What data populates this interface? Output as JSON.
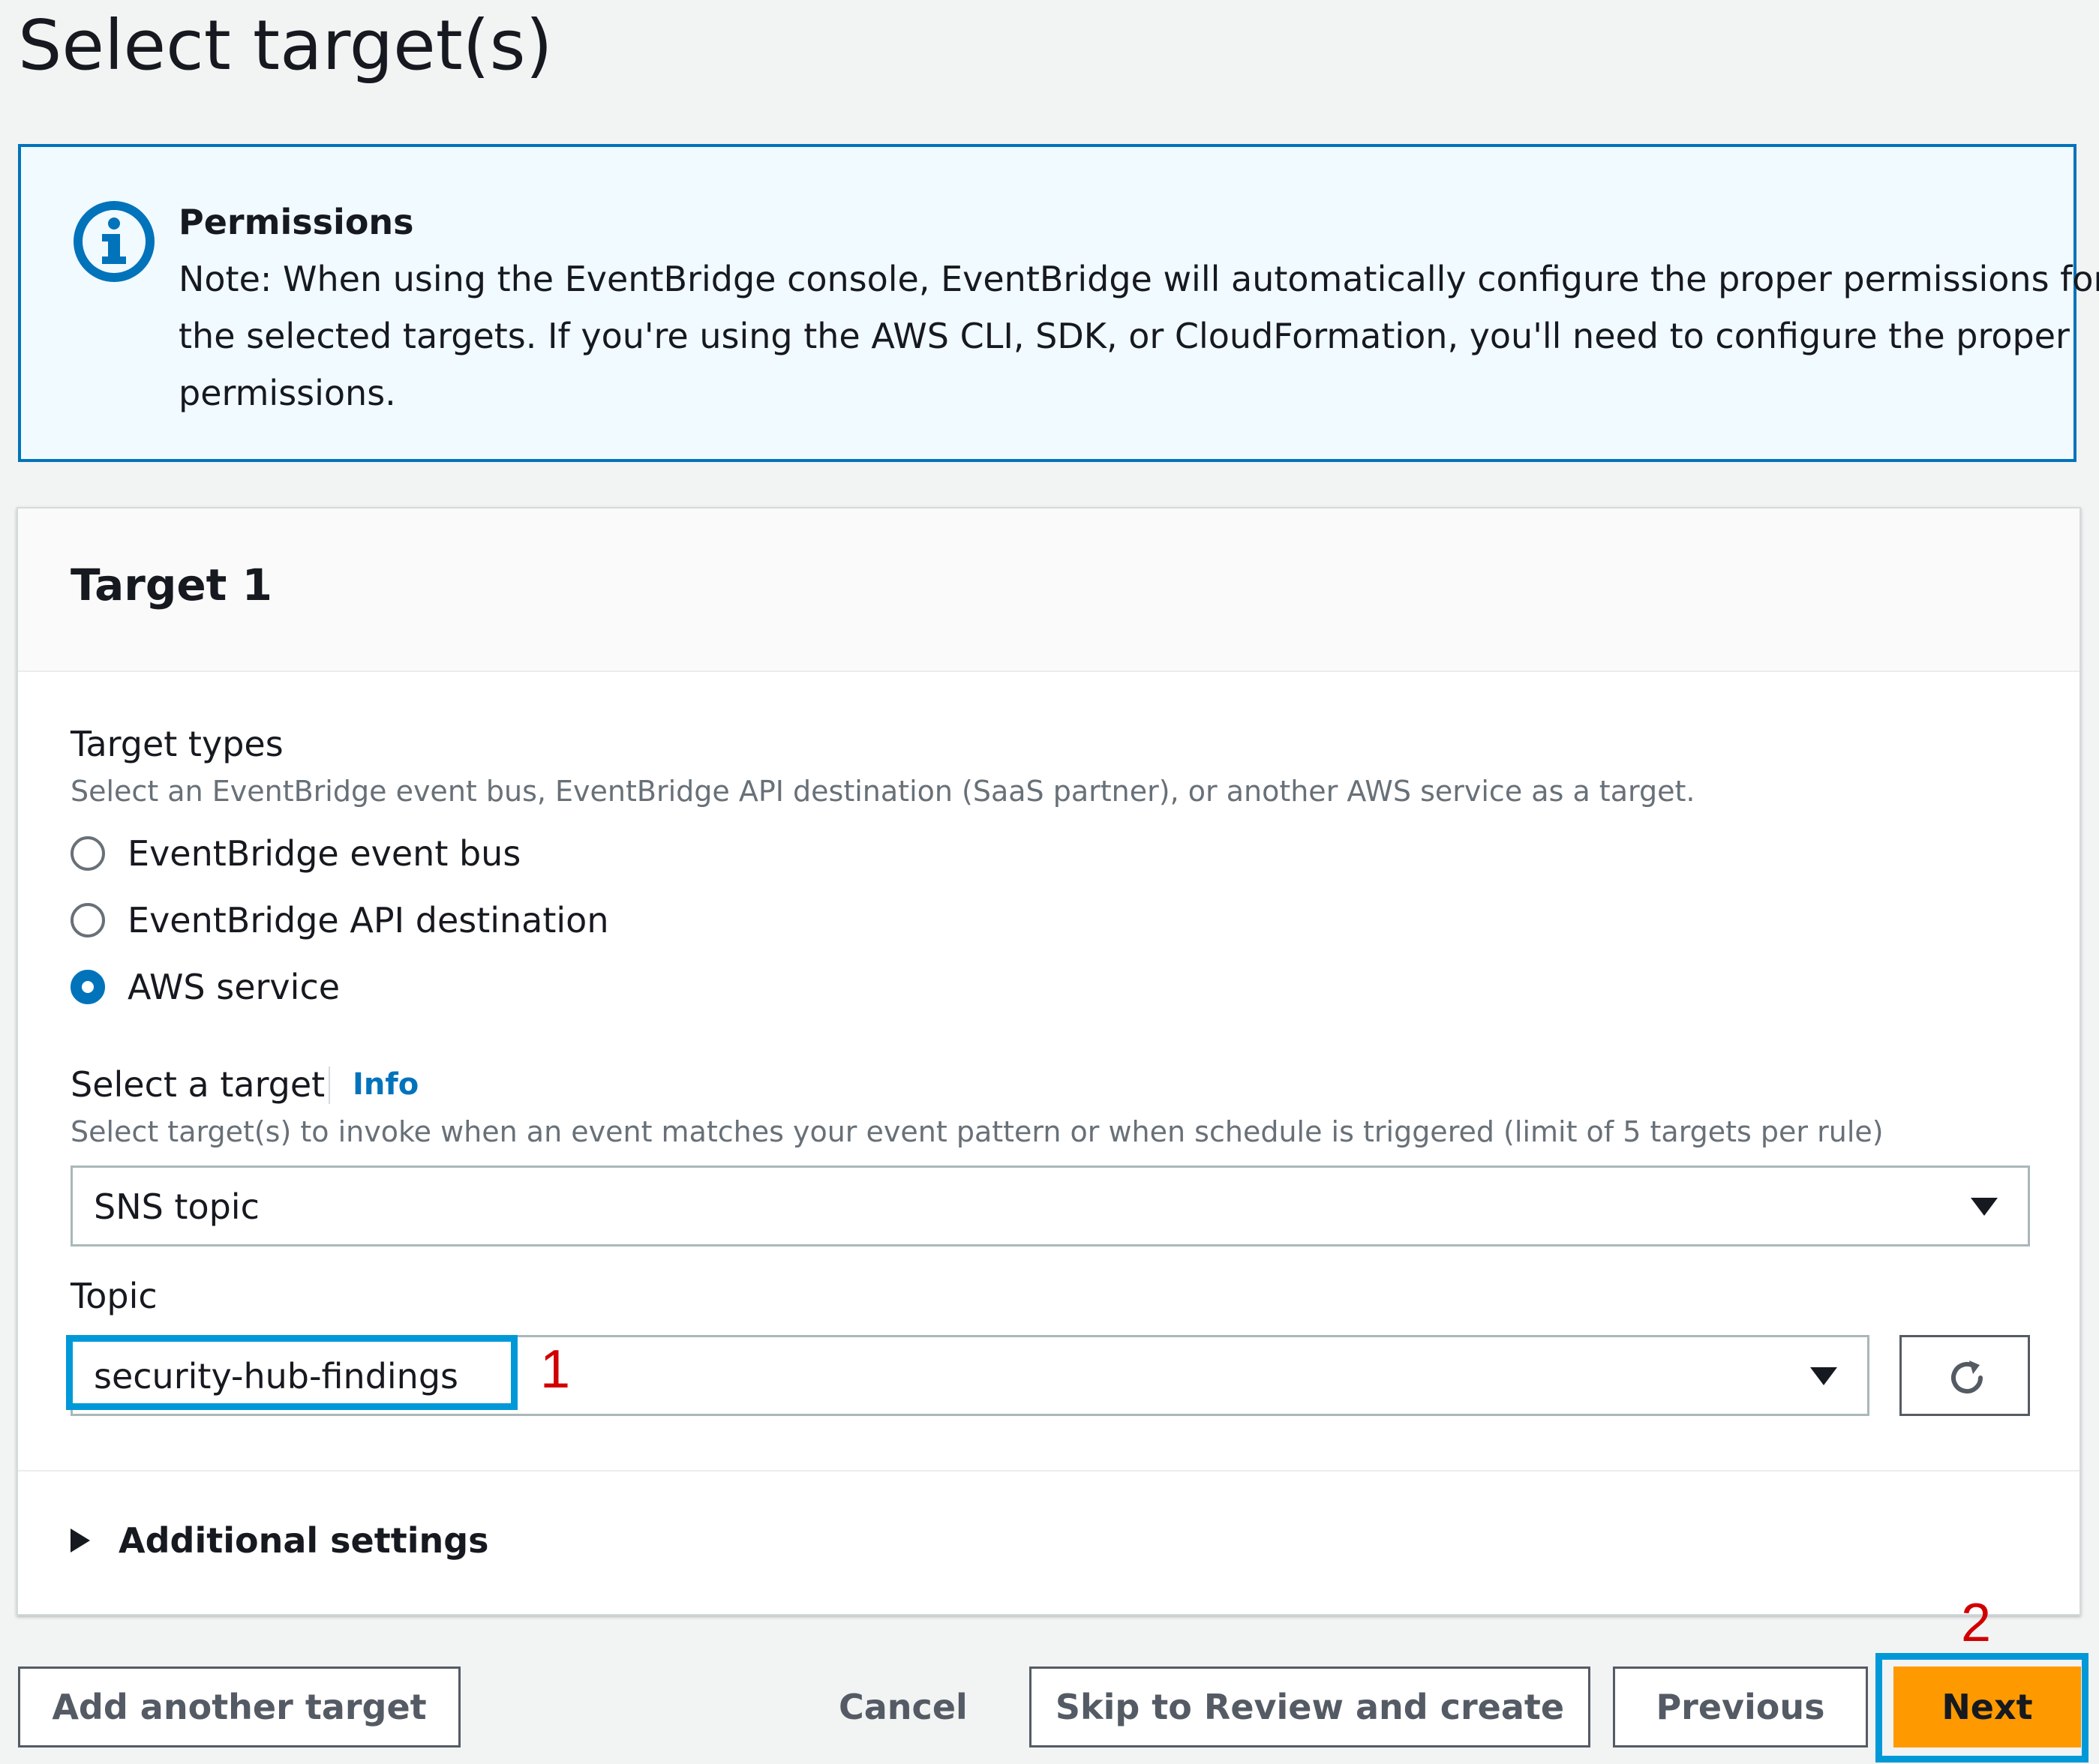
{
  "page": {
    "title": "Select target(s)"
  },
  "alert": {
    "icon": "info-icon",
    "title": "Permissions",
    "line1": "Note: When using the EventBridge console, EventBridge will automatically configure the proper permissions for",
    "line2": "the selected targets. If you're using the AWS CLI, SDK, or CloudFormation, you'll need to configure the proper",
    "line3": "permissions."
  },
  "target": {
    "title": "Target 1",
    "types_label": "Target types",
    "types_desc": "Select an EventBridge event bus, EventBridge API destination (SaaS partner), or another AWS service as a target.",
    "options": [
      {
        "label": "EventBridge event bus",
        "checked": false
      },
      {
        "label": "EventBridge API destination",
        "checked": false
      },
      {
        "label": "AWS service",
        "checked": true
      }
    ],
    "select_label": "Select a target",
    "info_link": "Info",
    "select_desc": "Select target(s) to invoke when an event matches your event pattern or when schedule is triggered (limit of 5 targets per rule)",
    "select_value": "SNS topic",
    "topic_label": "Topic",
    "topic_value": "security-hub-findings",
    "additional_settings": "Additional settings"
  },
  "annotations": {
    "one": "1",
    "two": "2"
  },
  "footer": {
    "add_target": "Add another target",
    "cancel": "Cancel",
    "skip": "Skip to Review and create",
    "previous": "Previous",
    "next": "Next"
  },
  "colors": {
    "accent": "#0073bb",
    "primary_button": "#ff9900",
    "highlight": "#0099d8",
    "annotation": "#d10000"
  }
}
